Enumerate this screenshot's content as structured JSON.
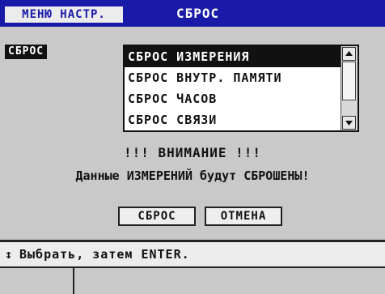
{
  "header": {
    "menu_tab": "МЕНЮ НАСТР.",
    "title": "СБРОС"
  },
  "field_label": "СБРОС",
  "reset_list": {
    "items": [
      "СБРОС ИЗМЕРЕНИЯ",
      "СБРОС ВНУТР. ПАМЯТИ",
      "СБРОС ЧАСОВ",
      "СБРОС СВЯЗИ"
    ],
    "selected_index": 0
  },
  "warning": {
    "title": "!!! ВНИМАНИЕ !!!",
    "message": "Данные ИЗМЕРЕНИЙ будут СБРОШЕНЫ!"
  },
  "buttons": {
    "reset": "СБРОС",
    "cancel": "ОТМЕНА"
  },
  "status": {
    "icon": "up-down-arrow-icon",
    "glyph": "↕",
    "text": "Выбрать, затем ENTER."
  },
  "colors": {
    "title_bar": "#1a1aa8",
    "background": "#c9c9c9",
    "selection": "#111111"
  }
}
